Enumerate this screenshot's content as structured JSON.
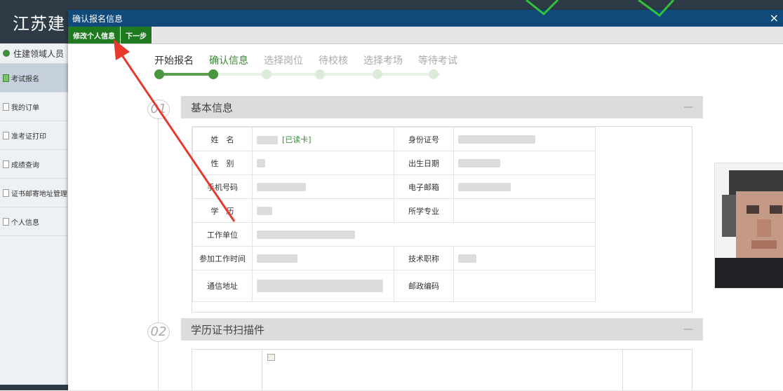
{
  "app": {
    "title": "江苏建"
  },
  "sidebar": {
    "user": "住建领域人员",
    "items": [
      {
        "label": "考试报名",
        "active": true
      },
      {
        "label": "我的订单",
        "active": false
      },
      {
        "label": "准考证打印",
        "active": false
      },
      {
        "label": "成绩查询",
        "active": false
      },
      {
        "label": "证书邮寄地址管理",
        "active": false
      },
      {
        "label": "个人信息",
        "active": false
      }
    ]
  },
  "dialog": {
    "title": "确认报名信息",
    "close": "×",
    "toolbar": {
      "edit_label": "修改个人信息",
      "next_label": "下一步"
    }
  },
  "steps": [
    {
      "label": "开始报名",
      "state": "done"
    },
    {
      "label": "确认信息",
      "state": "current"
    },
    {
      "label": "选择岗位",
      "state": "pending"
    },
    {
      "label": "待校核",
      "state": "pending"
    },
    {
      "label": "选择考场",
      "state": "pending"
    },
    {
      "label": "等待考试",
      "state": "pending"
    }
  ],
  "section1": {
    "number": "01",
    "title": "基本信息",
    "collapse": "—"
  },
  "section2": {
    "number": "02",
    "title": "学历证书扫描件",
    "collapse": "—"
  },
  "info": {
    "name_label": "姓　名",
    "read_card": "[已读卡]",
    "id_label": "身份证号",
    "gender_label": "性　别",
    "birth_label": "出生日期",
    "phone_label": "手机号码",
    "email_label": "电子邮箱",
    "edu_label": "学　历",
    "major_label": "所学专业",
    "work_label": "工作单位",
    "worktime_label": "参加工作时间",
    "title_label": "技术职称",
    "address_label": "通信地址",
    "zip_label": "邮政编码"
  },
  "colors": {
    "header": "#2e3b47",
    "dialog_title": "#0f4a7a",
    "button_green": "#1f7a1f",
    "step_green": "#4b9540",
    "annotation_red": "#e8392d",
    "annotation_green": "#2fc23a"
  }
}
